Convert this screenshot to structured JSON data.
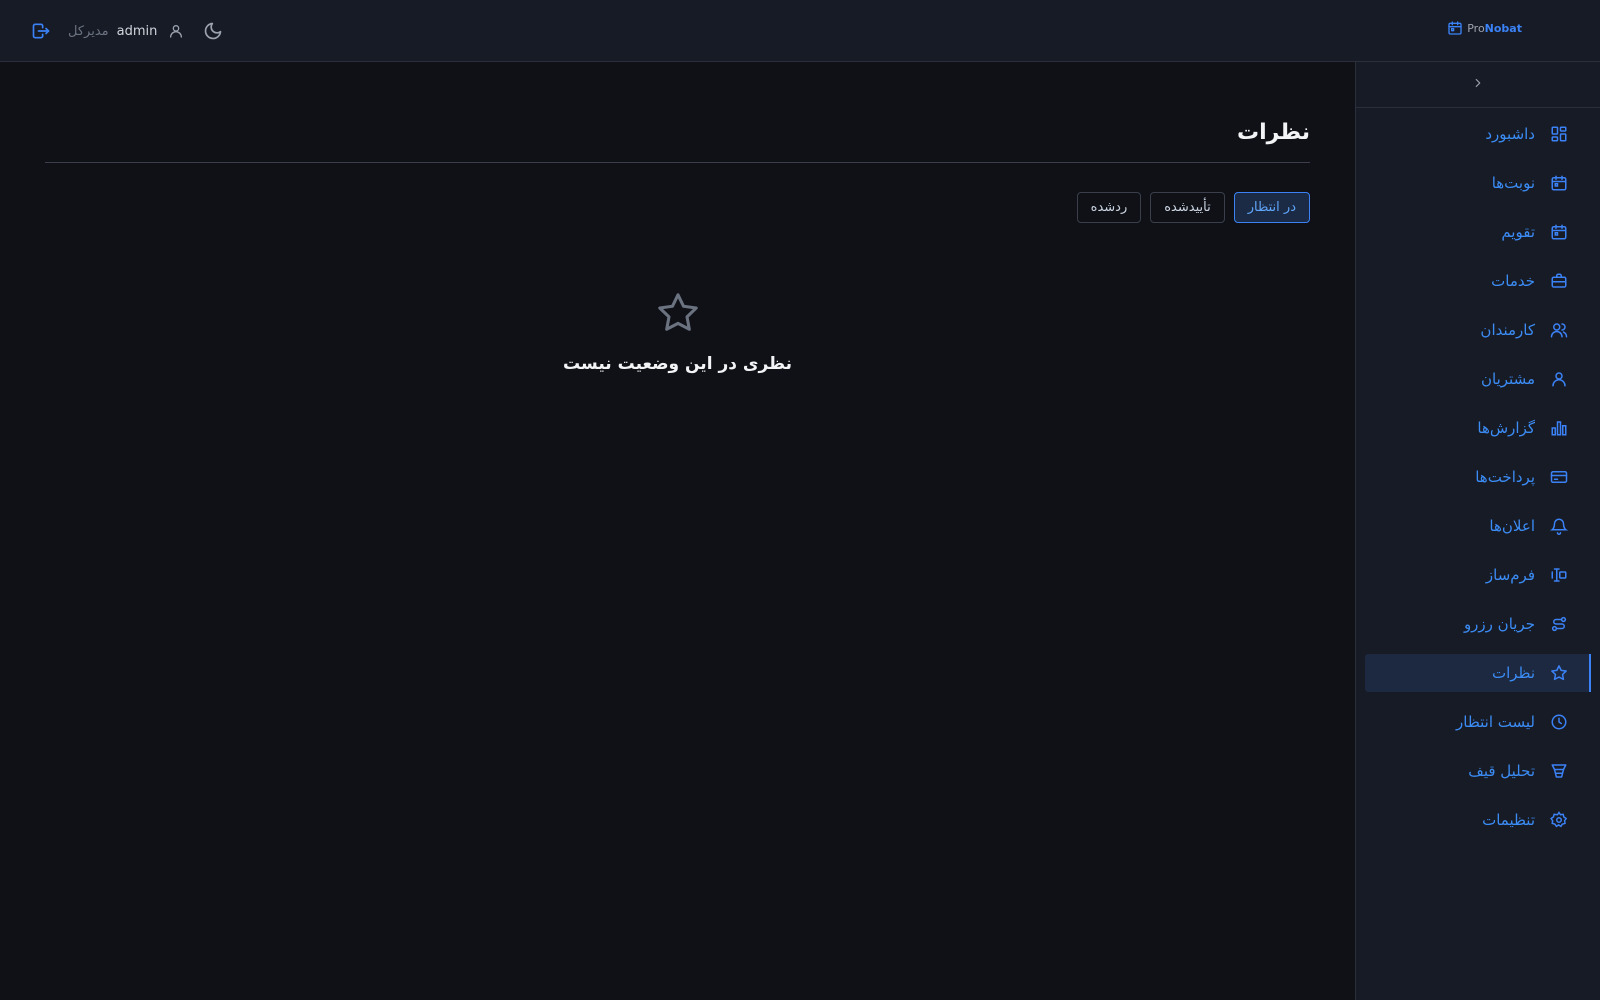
{
  "header": {
    "brand_pro": "Pro",
    "brand_nobat": "Nobat",
    "username": "admin",
    "role": "مدیرکل",
    "icons": [
      "logout-icon",
      "user-icon",
      "moon-icon",
      "calendar-icon"
    ]
  },
  "sidebar": {
    "items": [
      {
        "label": "داشبورد",
        "icon": "dashboard-icon"
      },
      {
        "label": "نوبت‌ها",
        "icon": "calendar-icon"
      },
      {
        "label": "تقویم",
        "icon": "calendar-icon"
      },
      {
        "label": "خدمات",
        "icon": "briefcase-icon"
      },
      {
        "label": "کارمندان",
        "icon": "users-icon"
      },
      {
        "label": "مشتریان",
        "icon": "user-icon"
      },
      {
        "label": "گزارش‌ها",
        "icon": "bar-chart-icon"
      },
      {
        "label": "پرداخت‌ها",
        "icon": "credit-card-icon"
      },
      {
        "label": "اعلان‌ها",
        "icon": "bell-icon"
      },
      {
        "label": "فرم‌ساز",
        "icon": "form-builder-icon"
      },
      {
        "label": "جریان رزرو",
        "icon": "flow-icon"
      },
      {
        "label": "نظرات",
        "icon": "star-icon",
        "active": true
      },
      {
        "label": "لیست انتظار",
        "icon": "clock-icon"
      },
      {
        "label": "تحلیل قیف",
        "icon": "funnel-icon"
      },
      {
        "label": "تنظیمات",
        "icon": "gear-icon"
      }
    ]
  },
  "main": {
    "title": "نظرات",
    "filters": [
      {
        "label": "در انتظار",
        "active": true
      },
      {
        "label": "تأییدشده",
        "active": false
      },
      {
        "label": "ردشده",
        "active": false
      }
    ],
    "empty_text": "نظری در این وضعیت نیست",
    "empty_icon": "star-icon"
  },
  "colors": {
    "background": "#0f1117",
    "panel": "#171b26",
    "accent": "#3b82f6",
    "border": "#2a2f3b"
  }
}
